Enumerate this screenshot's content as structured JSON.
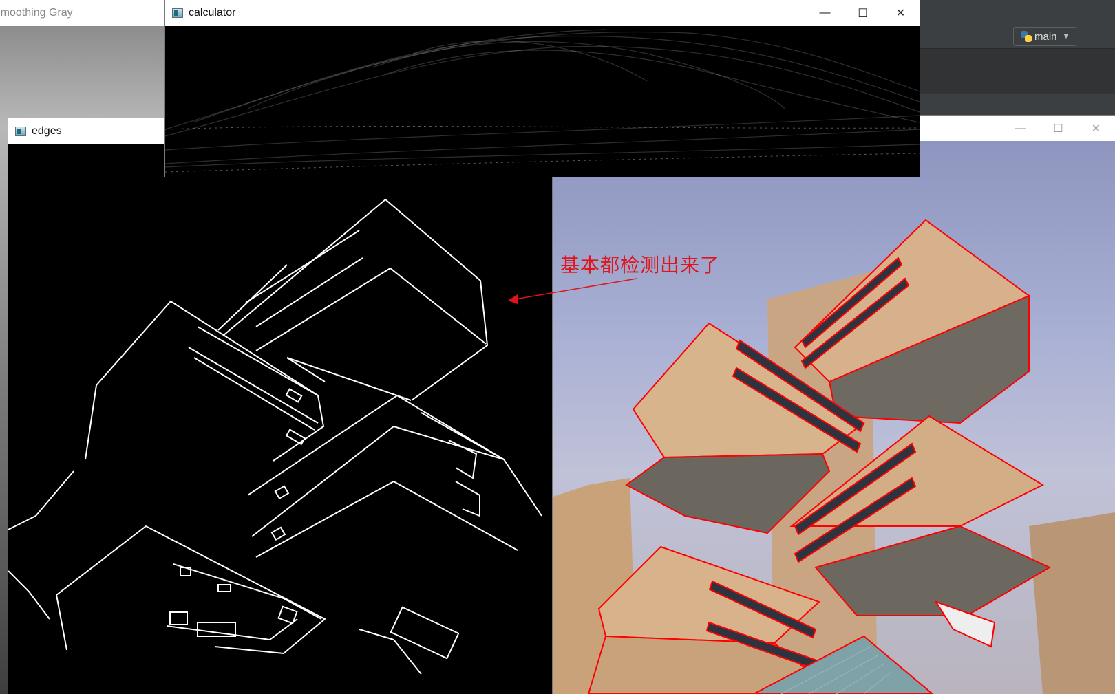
{
  "windows": {
    "smoothing": {
      "title": "Smoothing Gray"
    },
    "calculator": {
      "title": "calculator"
    },
    "edges": {
      "title": "edges"
    },
    "photo": {
      "title": ""
    }
  },
  "window_controls": {
    "minimize": "—",
    "maximize": "☐",
    "close": "✕"
  },
  "ide": {
    "run_config": "main"
  },
  "annotation": {
    "text": "基本都检测出来了",
    "color": "#e0141a"
  },
  "colors": {
    "edge_line": "#ffffff",
    "detected_contour": "#ff0000",
    "building": "#d2b48c"
  },
  "icons": {
    "app": "opencv-window-icon",
    "python": "python-icon"
  }
}
